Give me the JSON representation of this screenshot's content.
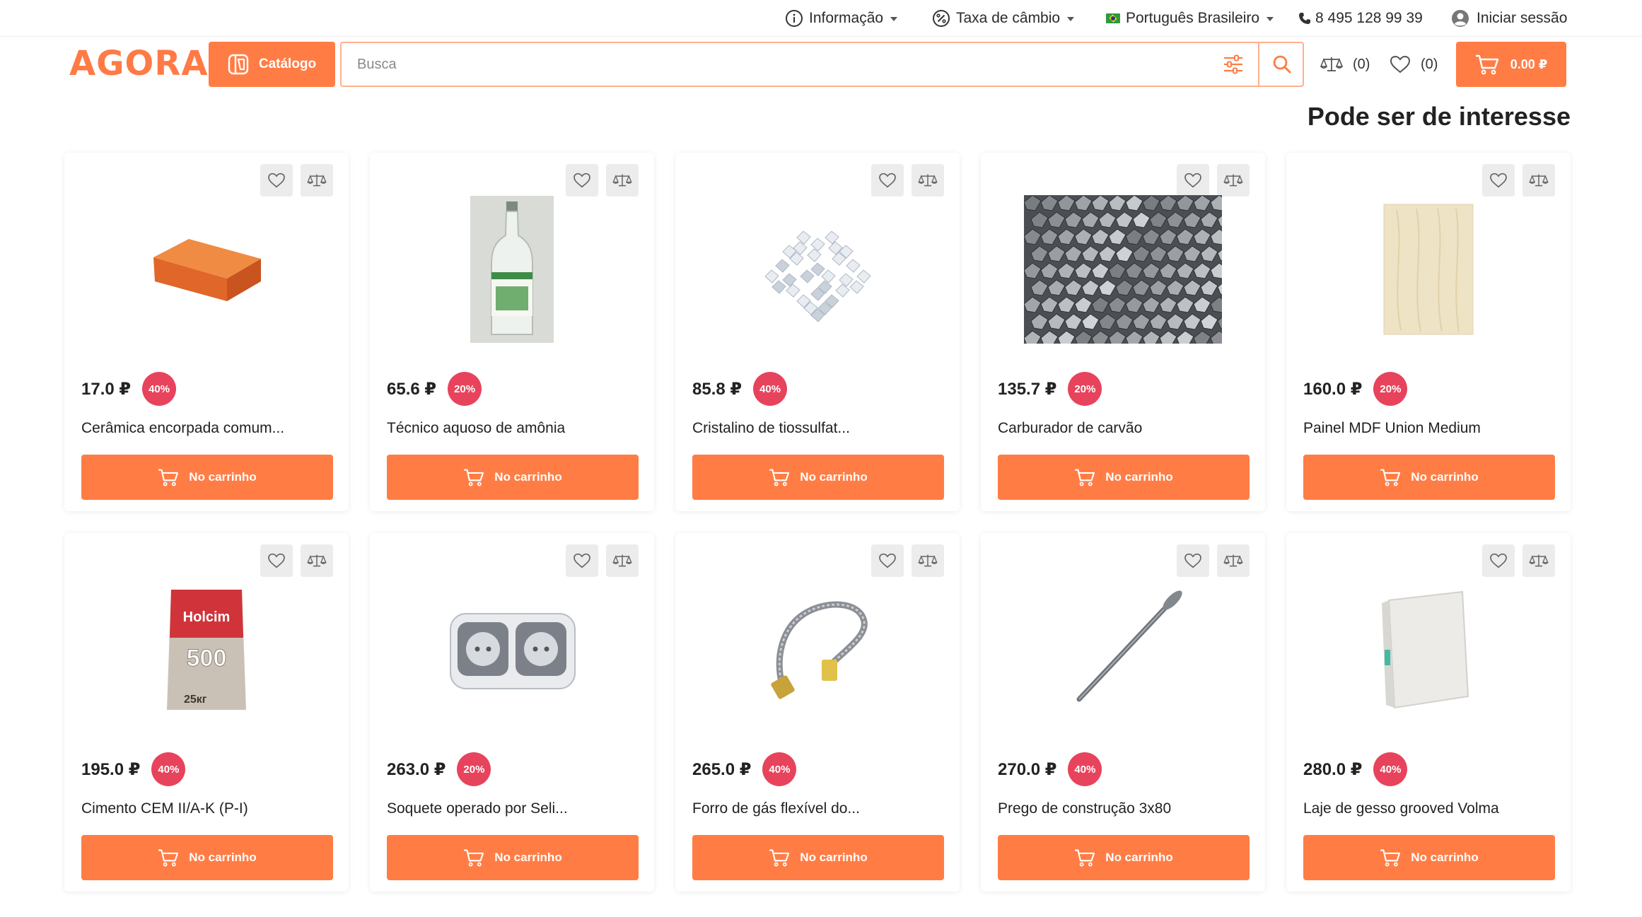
{
  "topbar": {
    "info": "Informação",
    "exchange": "Taxa de câmbio",
    "language": "Português Brasileiro",
    "phone": "8 495 128 99 39",
    "login": "Iniciar sessão"
  },
  "header": {
    "logo": "AGORA",
    "catalog_label": "Catálogo",
    "search_placeholder": "Busca",
    "compare_count": "(0)",
    "favorites_count": "(0)",
    "cart_total": "0.00 ₽"
  },
  "colors": {
    "accent": "#ff7d45",
    "badge": "#e8435c"
  },
  "section_title": "Pode ser de interesse",
  "products": [
    {
      "price": "17.0 ₽",
      "discount": "40%",
      "name": "Cerâmica encorpada comum...",
      "button": "No carrinho",
      "image": "brick"
    },
    {
      "price": "65.6 ₽",
      "discount": "20%",
      "name": "Técnico aquoso de amônia",
      "button": "No carrinho",
      "image": "bottle"
    },
    {
      "price": "85.8 ₽",
      "discount": "40%",
      "name": "Cristalino de tiossulfat...",
      "button": "No carrinho",
      "image": "crystals"
    },
    {
      "price": "135.7 ₽",
      "discount": "20%",
      "name": "Carburador de carvão",
      "button": "No carrinho",
      "image": "carbide"
    },
    {
      "price": "160.0 ₽",
      "discount": "20%",
      "name": "Painel MDF Union Medium",
      "button": "No carrinho",
      "image": "mdf-panel"
    },
    {
      "price": "195.0 ₽",
      "discount": "40%",
      "name": "Cimento CEM II/A-K (P-I)",
      "button": "No carrinho",
      "image": "cement-bag",
      "bag_brand": "Holcim",
      "bag_number": "500",
      "bag_weight": "25кг"
    },
    {
      "price": "263.0 ₽",
      "discount": "20%",
      "name": "Soquete operado por Seli...",
      "button": "No carrinho",
      "image": "socket"
    },
    {
      "price": "265.0 ₽",
      "discount": "40%",
      "name": "Forro de gás flexível do...",
      "button": "No carrinho",
      "image": "gas-hose"
    },
    {
      "price": "270.0 ₽",
      "discount": "40%",
      "name": "Prego de construção 3x80",
      "button": "No carrinho",
      "image": "nail"
    },
    {
      "price": "280.0 ₽",
      "discount": "40%",
      "name": "Laje de gesso grooved Volma",
      "button": "No carrinho",
      "image": "gypsum-slab"
    }
  ]
}
